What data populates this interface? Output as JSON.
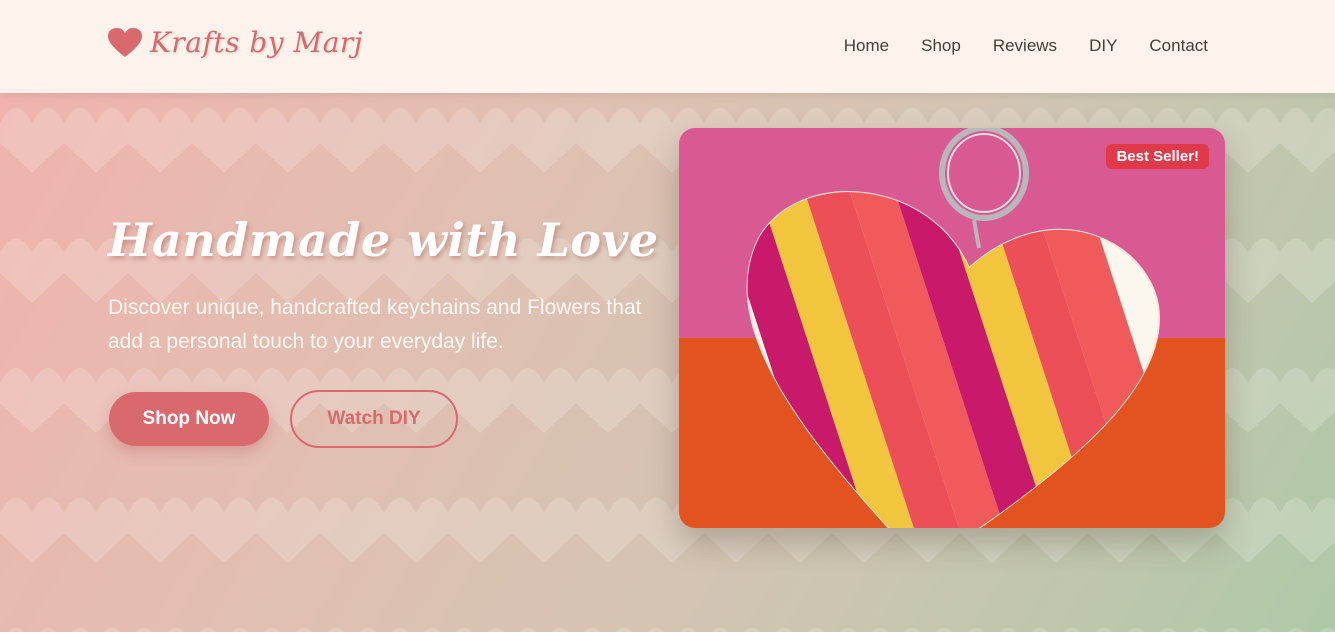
{
  "brand": {
    "name": "Krafts by Marj",
    "logo_icon": "heart-icon",
    "accent_color": "#d9696c"
  },
  "nav": {
    "items": [
      {
        "label": "Home"
      },
      {
        "label": "Shop"
      },
      {
        "label": "Reviews"
      },
      {
        "label": "DIY"
      },
      {
        "label": "Contact"
      }
    ]
  },
  "hero": {
    "title": "Handmade with Love",
    "subtitle": "Discover unique, handcrafted keychains and Flowers that add a personal touch to your everyday life.",
    "primary_button": "Shop Now",
    "secondary_button": "Watch DIY",
    "product_badge": "Best Seller!",
    "badge_color": "#e0394a"
  }
}
